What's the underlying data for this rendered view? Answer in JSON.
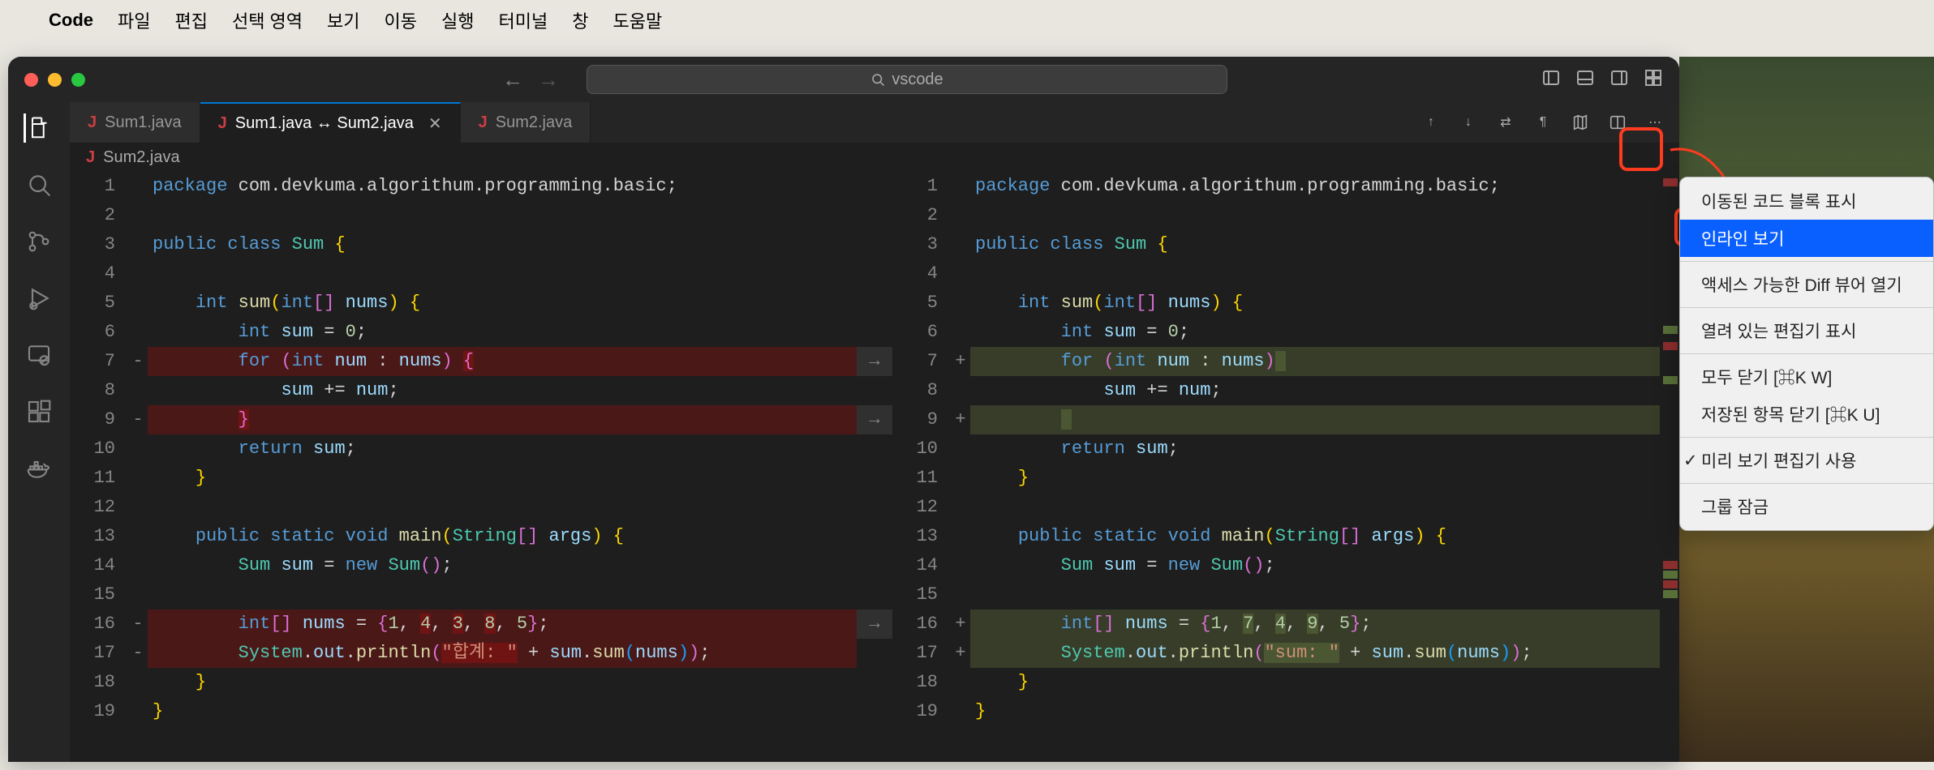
{
  "menubar": {
    "app": "Code",
    "items": [
      "파일",
      "편집",
      "선택 영역",
      "보기",
      "이동",
      "실행",
      "터미널",
      "창",
      "도움말"
    ]
  },
  "titlebar": {
    "search_placeholder": "vscode"
  },
  "tabs": [
    {
      "label": "Sum1.java",
      "active": false,
      "close": false
    },
    {
      "label": "Sum1.java ↔ Sum2.java",
      "active": true,
      "close": true
    },
    {
      "label": "Sum2.java",
      "active": false,
      "close": false
    }
  ],
  "breadcrumb": {
    "file": "Sum2.java"
  },
  "left_pane": {
    "lines": [
      {
        "n": 1,
        "sign": "",
        "cls": "",
        "html": "<span class='kw'>package</span> <span class='pkg'>com.devkuma.algorithum.programming.basic;</span>"
      },
      {
        "n": 2,
        "sign": "",
        "cls": "",
        "html": ""
      },
      {
        "n": 3,
        "sign": "",
        "cls": "",
        "html": "<span class='kw'>public</span> <span class='kw'>class</span> <span class='cls'>Sum</span> <span class='brace'>{</span>"
      },
      {
        "n": 4,
        "sign": "",
        "cls": "",
        "html": ""
      },
      {
        "n": 5,
        "sign": "",
        "cls": "",
        "html": "    <span class='kw'>int</span> <span class='fn'>sum</span><span class='brace'>(</span><span class='kw'>int</span><span class='brace2'>[]</span> <span class='var'>nums</span><span class='brace'>)</span> <span class='brace'>{</span>"
      },
      {
        "n": 6,
        "sign": "",
        "cls": "",
        "html": "        <span class='kw'>int</span> <span class='var'>sum</span> <span class='op'>=</span> <span class='num'>0</span><span class='plain'>;</span>"
      },
      {
        "n": 7,
        "sign": "-",
        "cls": "del",
        "html": "        <span class='kw'>for</span> <span class='brace2'>(</span><span class='kw'>int</span> <span class='var'>num</span> <span class='op'>:</span> <span class='var'>nums</span><span class='brace2'>)</span> <span class='inline-del'><span class='brace2'>{</span></span>"
      },
      {
        "n": 8,
        "sign": "",
        "cls": "",
        "html": "            <span class='var'>sum</span> <span class='op'>+=</span> <span class='var'>num</span><span class='plain'>;</span>"
      },
      {
        "n": 9,
        "sign": "-",
        "cls": "del",
        "html": "        <span class='inline-del'><span class='brace2'>}</span></span>"
      },
      {
        "n": 10,
        "sign": "",
        "cls": "",
        "html": "        <span class='kw'>return</span> <span class='var'>sum</span><span class='plain'>;</span>"
      },
      {
        "n": 11,
        "sign": "",
        "cls": "",
        "html": "    <span class='brace'>}</span>"
      },
      {
        "n": 12,
        "sign": "",
        "cls": "",
        "html": ""
      },
      {
        "n": 13,
        "sign": "",
        "cls": "",
        "html": "    <span class='kw'>public</span> <span class='kw'>static</span> <span class='kw'>void</span> <span class='fn'>main</span><span class='brace'>(</span><span class='cls'>String</span><span class='brace2'>[]</span> <span class='var'>args</span><span class='brace'>)</span> <span class='brace'>{</span>"
      },
      {
        "n": 14,
        "sign": "",
        "cls": "",
        "html": "        <span class='cls'>Sum</span> <span class='var'>sum</span> <span class='op'>=</span> <span class='kw'>new</span> <span class='cls'>Sum</span><span class='brace2'>()</span><span class='plain'>;</span>"
      },
      {
        "n": 15,
        "sign": "",
        "cls": "",
        "html": ""
      },
      {
        "n": 16,
        "sign": "-",
        "cls": "del",
        "html": "        <span class='kw'>int</span><span class='brace2'>[]</span> <span class='var'>nums</span> <span class='op'>=</span> <span class='brace2'>{</span><span class='num'>1</span><span class='plain'>,</span> <span class='inline-del'><span class='num'>4</span></span><span class='plain'>,</span> <span class='inline-del'><span class='num'>3</span></span><span class='plain'>,</span> <span class='inline-del'><span class='num'>8</span></span><span class='plain'>,</span> <span class='num'>5</span><span class='brace2'>}</span><span class='plain'>;</span>"
      },
      {
        "n": 17,
        "sign": "-",
        "cls": "del",
        "html": "        <span class='cls'>System</span><span class='plain'>.</span><span class='var'>out</span><span class='plain'>.</span><span class='fn'>println</span><span class='brace2'>(</span><span class='inline-del'><span class='str'>\"합계: \"</span></span> <span class='op'>+</span> <span class='var'>sum</span><span class='plain'>.</span><span class='fn'>sum</span><span class='brace3'>(</span><span class='var'>nums</span><span class='brace3'>)</span><span class='brace2'>)</span><span class='plain'>;</span>"
      },
      {
        "n": 18,
        "sign": "",
        "cls": "",
        "html": "    <span class='brace'>}</span>"
      },
      {
        "n": 19,
        "sign": "",
        "cls": "",
        "html": "<span class='brace'>}</span>"
      }
    ]
  },
  "right_pane": {
    "lines": [
      {
        "n": 1,
        "sign": "",
        "cls": "",
        "html": "<span class='kw'>package</span> <span class='pkg'>com.devkuma.algorithum.programming.basic;</span>"
      },
      {
        "n": 2,
        "sign": "",
        "cls": "",
        "html": ""
      },
      {
        "n": 3,
        "sign": "",
        "cls": "",
        "html": "<span class='kw'>public</span> <span class='kw'>class</span> <span class='cls'>Sum</span> <span class='brace'>{</span>"
      },
      {
        "n": 4,
        "sign": "",
        "cls": "",
        "html": ""
      },
      {
        "n": 5,
        "sign": "",
        "cls": "",
        "html": "    <span class='kw'>int</span> <span class='fn'>sum</span><span class='brace'>(</span><span class='kw'>int</span><span class='brace2'>[]</span> <span class='var'>nums</span><span class='brace'>)</span> <span class='brace'>{</span>"
      },
      {
        "n": 6,
        "sign": "",
        "cls": "",
        "html": "        <span class='kw'>int</span> <span class='var'>sum</span> <span class='op'>=</span> <span class='num'>0</span><span class='plain'>;</span>"
      },
      {
        "n": 7,
        "sign": "+",
        "cls": "add",
        "html": "        <span class='kw'>for</span> <span class='brace2'>(</span><span class='kw'>int</span> <span class='var'>num</span> <span class='op'>:</span> <span class='var'>nums</span><span class='brace2'>)</span><span class='inline-add'> </span>"
      },
      {
        "n": 8,
        "sign": "",
        "cls": "",
        "html": "            <span class='var'>sum</span> <span class='op'>+=</span> <span class='var'>num</span><span class='plain'>;</span>"
      },
      {
        "n": 9,
        "sign": "+",
        "cls": "add",
        "html": "        <span class='inline-add'> </span>"
      },
      {
        "n": 10,
        "sign": "",
        "cls": "",
        "html": "        <span class='kw'>return</span> <span class='var'>sum</span><span class='plain'>;</span>"
      },
      {
        "n": 11,
        "sign": "",
        "cls": "",
        "html": "    <span class='brace'>}</span>"
      },
      {
        "n": 12,
        "sign": "",
        "cls": "",
        "html": ""
      },
      {
        "n": 13,
        "sign": "",
        "cls": "",
        "html": "    <span class='kw'>public</span> <span class='kw'>static</span> <span class='kw'>void</span> <span class='fn'>main</span><span class='brace'>(</span><span class='cls'>String</span><span class='brace2'>[]</span> <span class='var'>args</span><span class='brace'>)</span> <span class='brace'>{</span>"
      },
      {
        "n": 14,
        "sign": "",
        "cls": "",
        "html": "        <span class='cls'>Sum</span> <span class='var'>sum</span> <span class='op'>=</span> <span class='kw'>new</span> <span class='cls'>Sum</span><span class='brace2'>()</span><span class='plain'>;</span>"
      },
      {
        "n": 15,
        "sign": "",
        "cls": "",
        "html": ""
      },
      {
        "n": 16,
        "sign": "+",
        "cls": "add",
        "html": "        <span class='kw'>int</span><span class='brace2'>[]</span> <span class='var'>nums</span> <span class='op'>=</span> <span class='brace2'>{</span><span class='num'>1</span><span class='plain'>,</span> <span class='inline-add'><span class='num'>7</span></span><span class='plain'>,</span> <span class='inline-add'><span class='num'>4</span></span><span class='plain'>,</span> <span class='inline-add'><span class='num'>9</span></span><span class='plain'>,</span> <span class='num'>5</span><span class='brace2'>}</span><span class='plain'>;</span>"
      },
      {
        "n": 17,
        "sign": "+",
        "cls": "add",
        "html": "        <span class='cls'>System</span><span class='plain'>.</span><span class='var'>out</span><span class='plain'>.</span><span class='fn'>println</span><span class='brace2'>(</span><span class='inline-add'><span class='str'>\"sum: \"</span></span> <span class='op'>+</span> <span class='var'>sum</span><span class='plain'>.</span><span class='fn'>sum</span><span class='brace3'>(</span><span class='var'>nums</span><span class='brace3'>)</span><span class='brace2'>)</span><span class='plain'>;</span>"
      },
      {
        "n": 18,
        "sign": "",
        "cls": "",
        "html": "    <span class='brace'>}</span>"
      },
      {
        "n": 19,
        "sign": "",
        "cls": "",
        "html": "<span class='brace'>}</span>"
      }
    ]
  },
  "arrow_rows": [
    6,
    8,
    15
  ],
  "context_menu": {
    "items": [
      {
        "label": "이동된 코드 블록 표시",
        "selected": false,
        "check": false
      },
      {
        "label": "인라인 보기",
        "selected": true,
        "check": false
      },
      {
        "sep": true
      },
      {
        "label": "액세스 가능한 Diff 뷰어 열기",
        "selected": false,
        "check": false
      },
      {
        "sep": true
      },
      {
        "label": "열려 있는 편집기 표시",
        "selected": false,
        "check": false
      },
      {
        "sep": true
      },
      {
        "label": "모두 닫기 [⌘K W]",
        "selected": false,
        "check": false
      },
      {
        "label": "저장된 항목 닫기 [⌘K U]",
        "selected": false,
        "check": false
      },
      {
        "sep": true
      },
      {
        "label": "미리 보기 편집기 사용",
        "selected": false,
        "check": true
      },
      {
        "sep": true
      },
      {
        "label": "그룹 잠금",
        "selected": false,
        "check": false
      }
    ]
  }
}
